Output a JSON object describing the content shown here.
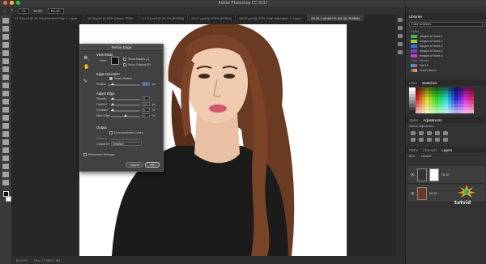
{
  "window": {
    "title": "Adobe Photoshop CC 2017"
  },
  "options_bar": {
    "brush_size": "70",
    "mode_label": "Mode",
    "mode_value": "Brush"
  },
  "tabs": [
    {
      "label": "01-03.psd @ 33.3% (Gradient Map 1, Layer..."
    },
    {
      "label": "06-08.psd @ 50% (Stone, RGB..."
    },
    {
      "label": "07-21.psd @ 33.3% (RGB/8)"
    },
    {
      "label": "22-27.psd @ 100% (RGB/8)"
    },
    {
      "label": "28-32.psd @ 33% (Hue Saturation 1, Layer..."
    },
    {
      "label": "29-32-1 @ 66.7% (29-32, RGB/8)"
    }
  ],
  "dialog": {
    "title": "Refine Edge",
    "view_mode": "View Mode",
    "view_label": "View:",
    "show_radius": "Show Radius (J)",
    "show_original": "Show Original (P)",
    "edge_detection": "Edge Detection",
    "smart_radius": "Smart Radius",
    "radius_label": "Radius:",
    "radius_value": "2.0",
    "radius_unit": "px",
    "adjust_edge": "Adjust Edge",
    "smooth_label": "Smooth:",
    "smooth_value": "0",
    "feather_label": "Feather:",
    "feather_value": "0.0",
    "feather_unit": "px",
    "contrast_label": "Contrast:",
    "contrast_value": "0",
    "contrast_unit": "%",
    "shift_label": "Shift Edge:",
    "shift_value": "0",
    "shift_unit": "%",
    "output": "Output",
    "decontaminate": "Decontaminate Colors",
    "amount_label": "Amount:",
    "output_to_label": "Output To:",
    "output_to_value": "Selection",
    "remember": "Remember Settings",
    "cancel": "Cancel",
    "ok": "OK"
  },
  "libraries": {
    "title": "Libraries",
    "selector": "Color Schemes",
    "section_colors": "Colors",
    "items": [
      {
        "label": "elegant of tones 1",
        "color": "#3fb950"
      },
      {
        "label": "elegant of tones 2",
        "color": "#8fd13a"
      },
      {
        "label": "elegant of tones 3",
        "color": "#3a6fd8"
      },
      {
        "label": "elegant of tones 4",
        "color": "#7a3ad8"
      },
      {
        "label": "elegant of tones 5",
        "color": "#c83ad0"
      }
    ],
    "section_themes": "Color Themes",
    "theme_label": "Flat UI",
    "theme_label2": "Nouth Brown"
  },
  "swatches": {
    "tabs": [
      "Color",
      "Swatches"
    ],
    "active": "Swatches"
  },
  "adjustments": {
    "tabs": [
      "Styles",
      "Adjustments"
    ],
    "active": "Adjustments",
    "hint": "Add an adjustment"
  },
  "layers": {
    "tabs": [
      "Paths",
      "Channels",
      "Layers"
    ],
    "active": "Layers",
    "kind": "Kind",
    "blend": "Normal",
    "items": [
      {
        "name": "28-32"
      },
      {
        "name": "28-32"
      }
    ]
  },
  "status": {
    "zoom": "66.67%",
    "doc": "Doc: 17.6M/17.6M"
  },
  "watermark": "tutvid"
}
